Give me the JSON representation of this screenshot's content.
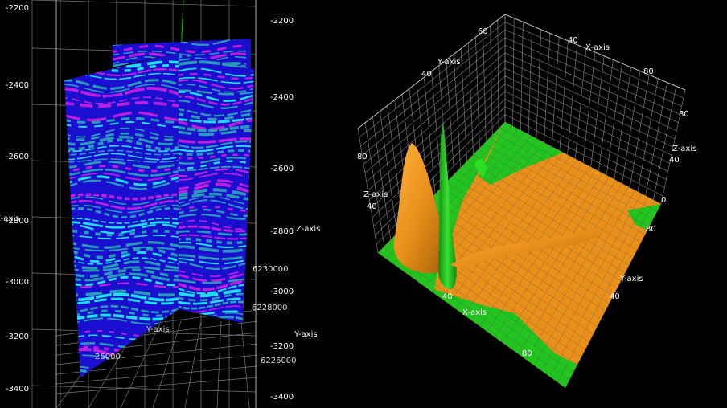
{
  "chart_data": [
    {
      "type": "3d-seismic-sections",
      "z_axis": {
        "label": "Z-axis",
        "ticks_left": [
          "-2200",
          "-2400",
          "-2600",
          "-2800",
          "-3000",
          "-3200",
          "-3400"
        ],
        "ticks_right": [
          "-2200",
          "-2400",
          "-2600",
          "-2800",
          "-3000",
          "-3200",
          "-3400"
        ]
      },
      "y_axis": {
        "label": "Y-axis",
        "ticks": [
          "6230000",
          "6228000",
          "6226000"
        ]
      },
      "x_axis": {
        "label": "Y-axis",
        "ticks": [
          "26000"
        ]
      },
      "colors": {
        "deep": "#1a0fcf",
        "mid": "#2aa7b8",
        "cyan": "#1ff5f2",
        "magenta": "#cc20e0",
        "axis_green": "#00cc00"
      }
    },
    {
      "type": "3d-surface",
      "x_axis_top": {
        "label": "X-axis",
        "ticks": [
          "40",
          "80"
        ]
      },
      "y_axis_top": {
        "label": "Y-axis",
        "ticks": [
          "60",
          "40"
        ]
      },
      "z_axis_left": {
        "label": "Z-axis",
        "ticks": [
          "80",
          "40"
        ]
      },
      "z_axis_right": {
        "label": "Z-axis",
        "ticks": [
          "80",
          "40",
          "0"
        ]
      },
      "y_axis_bottom": {
        "label": "Y-axis",
        "ticks": [
          "80",
          "40"
        ]
      },
      "x_axis_bottom": {
        "label": "X-axis",
        "ticks": [
          "40",
          "80"
        ]
      },
      "colors": {
        "surface_a": "#e8901a",
        "surface_b": "#22c41e",
        "grid": "#9a9a9a"
      }
    }
  ]
}
